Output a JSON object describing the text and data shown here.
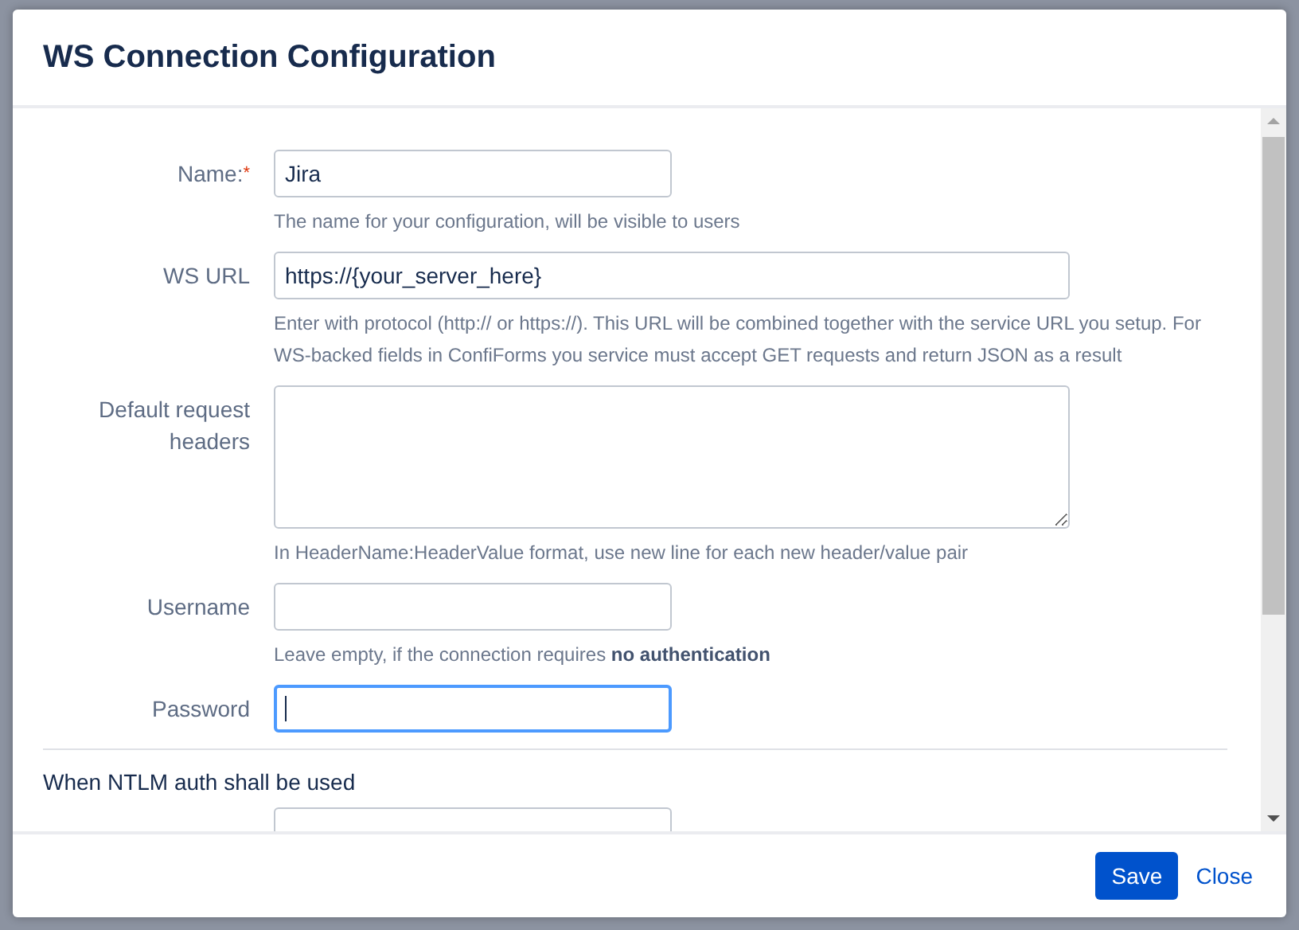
{
  "dialog": {
    "title": "WS Connection Configuration",
    "fields": [
      {
        "kind": "short_input",
        "label": "Name:",
        "required": true,
        "required_mark": "*",
        "value": "Jira",
        "help": "The name for your configuration, will be visible to users"
      },
      {
        "kind": "long_input",
        "label": "WS URL",
        "value": "https://{your_server_here}",
        "help": "Enter with protocol (http:// or https://). This URL will be combined together with the service URL you setup. For WS-backed fields in ConfiForms you service must accept GET requests and return JSON as a result"
      },
      {
        "kind": "textarea",
        "label": "Default request headers",
        "help": "In HeaderName:HeaderValue format, use new line for each new header/value pair"
      },
      {
        "kind": "short_input",
        "label": "Username",
        "help": "Leave empty, if the connection requires **no authentication**"
      },
      {
        "kind": "password",
        "label": "Password",
        "focused": true
      }
    ],
    "section_title": "When NTLM auth shall be used",
    "buttons": [
      {
        "label": "Save",
        "kind": "primary"
      },
      {
        "label": "Close",
        "kind": "link"
      }
    ]
  }
}
